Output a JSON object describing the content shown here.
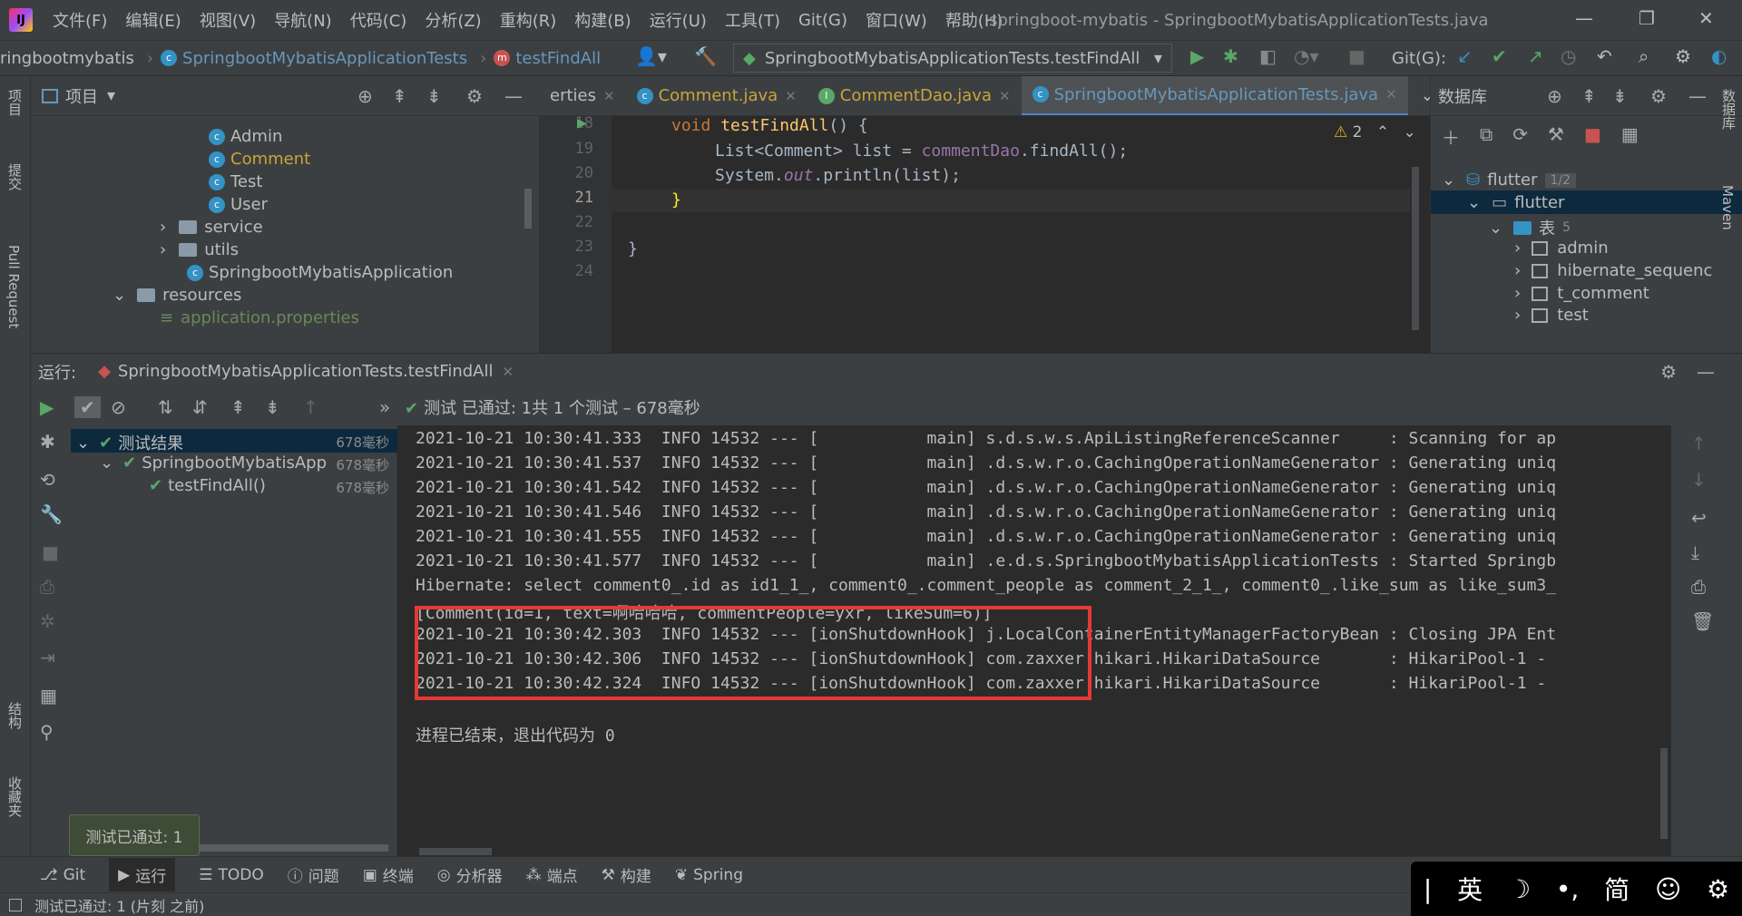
{
  "menubar": {
    "items": [
      "文件(F)",
      "编辑(E)",
      "视图(V)",
      "导航(N)",
      "代码(C)",
      "分析(Z)",
      "重构(R)",
      "构建(B)",
      "运行(U)",
      "工具(T)",
      "Git(G)",
      "窗口(W)",
      "帮助(H)"
    ],
    "title": "springboot-mybatis - SpringbootMybatisApplicationTests.java"
  },
  "navbar": {
    "project": "ringbootmybatis",
    "cls": "SpringbootMybatisApplicationTests",
    "method": "testFindAll",
    "run_config": "SpringbootMybatisApplicationTests.testFindAll",
    "git_label": "Git(G):"
  },
  "left_strip": {
    "project": "项目",
    "commit": "提交",
    "pull": "Pull Request",
    "structure": "结构",
    "favorites": "收藏夹"
  },
  "project_panel": {
    "title": "项目",
    "items": [
      "Admin",
      "Comment",
      "Test",
      "User",
      "service",
      "utils",
      "SpringbootMybatisApplication",
      "resources",
      "application.properties"
    ]
  },
  "editor": {
    "tabs": [
      "erties",
      "Comment.java",
      "CommentDao.java",
      "SpringbootMybatisApplicationTests.java"
    ],
    "warning_count": "2",
    "line_numbers": [
      "18",
      "19",
      "20",
      "21",
      "22",
      "23",
      "24"
    ],
    "lines": [
      {
        "kw": "void ",
        "name": "testFindAll",
        "rest": "() {"
      },
      {
        "text1": "List<Comment> list = ",
        "fld": "commentDao",
        "text2": ".findAll();"
      },
      {
        "text1": "System.",
        "fld": "out",
        "text2": ".println(list);"
      },
      {
        "text1": "}"
      },
      {
        "text1": ""
      },
      {
        "text1": "}"
      },
      {
        "text1": ""
      }
    ]
  },
  "db_panel": {
    "title": "数据库",
    "ds": "flutter",
    "ds_badge": "1/2",
    "schema": "flutter",
    "tables_label": "表",
    "tables_count": "5",
    "tables": [
      "admin",
      "hibernate_sequenc",
      "t_comment",
      "test"
    ]
  },
  "right_strip": {
    "database": "数据库",
    "maven": "Maven"
  },
  "run": {
    "label": "运行:",
    "config": "SpringbootMybatisApplicationTests.testFindAll",
    "status": "测试 已通过: 1共 1 个测试 – 678毫秒",
    "tree": [
      {
        "label": "测试结果",
        "time": "678毫秒"
      },
      {
        "label": "SpringbootMybatisApp",
        "time": "678毫秒"
      },
      {
        "label": "testFindAll()",
        "time": "678毫秒"
      }
    ],
    "console": [
      "2021-10-21 10:30:41.333  INFO 14532 --- [           main] s.d.s.w.s.ApiListingReferenceScanner     : Scanning for ap",
      "2021-10-21 10:30:41.537  INFO 14532 --- [           main] .d.s.w.r.o.CachingOperationNameGenerator : Generating uniq",
      "2021-10-21 10:30:41.542  INFO 14532 --- [           main] .d.s.w.r.o.CachingOperationNameGenerator : Generating uniq",
      "2021-10-21 10:30:41.546  INFO 14532 --- [           main] .d.s.w.r.o.CachingOperationNameGenerator : Generating uniq",
      "2021-10-21 10:30:41.555  INFO 14532 --- [           main] .d.s.w.r.o.CachingOperationNameGenerator : Generating uniq",
      "2021-10-21 10:30:41.577  INFO 14532 --- [           main] .e.d.s.SpringbootMybatisApplicationTests : Started Springb",
      "Hibernate: select comment0_.id as id1_1_, comment0_.comment_people as comment_2_1_, comment0_.like_sum as like_sum3_",
      "[Comment(id=1, text=啊哈哈哈, commentPeople=yxr, likeSum=6)]",
      "2021-10-21 10:30:42.303  INFO 14532 --- [ionShutdownHook] j.LocalContainerEntityManagerFactoryBean : Closing JPA Ent",
      "2021-10-21 10:30:42.306  INFO 14532 --- [ionShutdownHook] com.zaxxer.hikari.HikariDataSource       : HikariPool-1 -",
      "2021-10-21 10:30:42.324  INFO 14532 --- [ionShutdownHook] com.zaxxer.hikari.HikariDataSource       : HikariPool-1 -",
      "",
      "进程已结束，退出代码为 0"
    ]
  },
  "tooltip": "测试已通过: 1",
  "bottom_tabs": [
    "Git",
    "运行",
    "TODO",
    "问题",
    "终端",
    "分析器",
    "端点",
    "构建",
    "Spring"
  ],
  "statusbar": "测试已通过: 1 (片刻 之前)",
  "ime": [
    "英",
    "简"
  ],
  "colors": {
    "highlight": "#e53935",
    "pass": "#59a869",
    "accent": "#4a88c7"
  }
}
